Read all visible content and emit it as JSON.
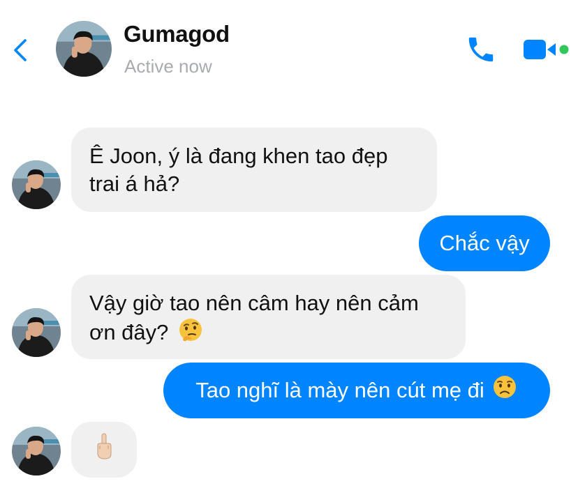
{
  "header": {
    "title": "Gumagod",
    "status": "Active now",
    "back_icon": "chevron-left-icon",
    "call_icon": "phone-icon",
    "video_icon": "video-camera-icon",
    "accent_color": "#0084ff",
    "online_color": "#31c75c"
  },
  "messages": [
    {
      "direction": "incoming",
      "text": "Ê Joon, ý là đang khen tao đẹp trai á hả?"
    },
    {
      "direction": "outgoing",
      "text": "Chắc vậy"
    },
    {
      "direction": "incoming",
      "text": "Vậy giờ tao nên câm hay nên cảm ơn đây?",
      "emoji": "thinking-face-icon"
    },
    {
      "direction": "outgoing",
      "text": "Tao nghĩ là mày nên cút mẹ đi",
      "emoji": "worried-face-icon"
    },
    {
      "direction": "incoming",
      "text": "",
      "emoji": "middle-finger-icon"
    }
  ],
  "colors": {
    "incoming_bubble": "#f0f0f0",
    "outgoing_bubble": "#0084ff"
  }
}
